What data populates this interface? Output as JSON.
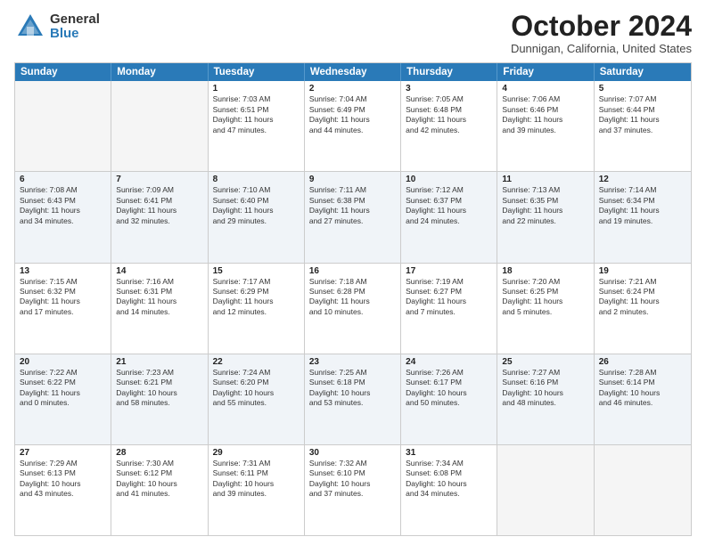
{
  "header": {
    "logo": {
      "general": "General",
      "blue": "Blue"
    },
    "title": "October 2024",
    "location": "Dunnigan, California, United States"
  },
  "weekdays": [
    "Sunday",
    "Monday",
    "Tuesday",
    "Wednesday",
    "Thursday",
    "Friday",
    "Saturday"
  ],
  "rows": [
    {
      "alt": false,
      "cells": [
        {
          "day": "",
          "empty": true
        },
        {
          "day": "",
          "empty": true
        },
        {
          "day": "1",
          "lines": [
            "Sunrise: 7:03 AM",
            "Sunset: 6:51 PM",
            "Daylight: 11 hours",
            "and 47 minutes."
          ]
        },
        {
          "day": "2",
          "lines": [
            "Sunrise: 7:04 AM",
            "Sunset: 6:49 PM",
            "Daylight: 11 hours",
            "and 44 minutes."
          ]
        },
        {
          "day": "3",
          "lines": [
            "Sunrise: 7:05 AM",
            "Sunset: 6:48 PM",
            "Daylight: 11 hours",
            "and 42 minutes."
          ]
        },
        {
          "day": "4",
          "lines": [
            "Sunrise: 7:06 AM",
            "Sunset: 6:46 PM",
            "Daylight: 11 hours",
            "and 39 minutes."
          ]
        },
        {
          "day": "5",
          "lines": [
            "Sunrise: 7:07 AM",
            "Sunset: 6:44 PM",
            "Daylight: 11 hours",
            "and 37 minutes."
          ]
        }
      ]
    },
    {
      "alt": true,
      "cells": [
        {
          "day": "6",
          "lines": [
            "Sunrise: 7:08 AM",
            "Sunset: 6:43 PM",
            "Daylight: 11 hours",
            "and 34 minutes."
          ]
        },
        {
          "day": "7",
          "lines": [
            "Sunrise: 7:09 AM",
            "Sunset: 6:41 PM",
            "Daylight: 11 hours",
            "and 32 minutes."
          ]
        },
        {
          "day": "8",
          "lines": [
            "Sunrise: 7:10 AM",
            "Sunset: 6:40 PM",
            "Daylight: 11 hours",
            "and 29 minutes."
          ]
        },
        {
          "day": "9",
          "lines": [
            "Sunrise: 7:11 AM",
            "Sunset: 6:38 PM",
            "Daylight: 11 hours",
            "and 27 minutes."
          ]
        },
        {
          "day": "10",
          "lines": [
            "Sunrise: 7:12 AM",
            "Sunset: 6:37 PM",
            "Daylight: 11 hours",
            "and 24 minutes."
          ]
        },
        {
          "day": "11",
          "lines": [
            "Sunrise: 7:13 AM",
            "Sunset: 6:35 PM",
            "Daylight: 11 hours",
            "and 22 minutes."
          ]
        },
        {
          "day": "12",
          "lines": [
            "Sunrise: 7:14 AM",
            "Sunset: 6:34 PM",
            "Daylight: 11 hours",
            "and 19 minutes."
          ]
        }
      ]
    },
    {
      "alt": false,
      "cells": [
        {
          "day": "13",
          "lines": [
            "Sunrise: 7:15 AM",
            "Sunset: 6:32 PM",
            "Daylight: 11 hours",
            "and 17 minutes."
          ]
        },
        {
          "day": "14",
          "lines": [
            "Sunrise: 7:16 AM",
            "Sunset: 6:31 PM",
            "Daylight: 11 hours",
            "and 14 minutes."
          ]
        },
        {
          "day": "15",
          "lines": [
            "Sunrise: 7:17 AM",
            "Sunset: 6:29 PM",
            "Daylight: 11 hours",
            "and 12 minutes."
          ]
        },
        {
          "day": "16",
          "lines": [
            "Sunrise: 7:18 AM",
            "Sunset: 6:28 PM",
            "Daylight: 11 hours",
            "and 10 minutes."
          ]
        },
        {
          "day": "17",
          "lines": [
            "Sunrise: 7:19 AM",
            "Sunset: 6:27 PM",
            "Daylight: 11 hours",
            "and 7 minutes."
          ]
        },
        {
          "day": "18",
          "lines": [
            "Sunrise: 7:20 AM",
            "Sunset: 6:25 PM",
            "Daylight: 11 hours",
            "and 5 minutes."
          ]
        },
        {
          "day": "19",
          "lines": [
            "Sunrise: 7:21 AM",
            "Sunset: 6:24 PM",
            "Daylight: 11 hours",
            "and 2 minutes."
          ]
        }
      ]
    },
    {
      "alt": true,
      "cells": [
        {
          "day": "20",
          "lines": [
            "Sunrise: 7:22 AM",
            "Sunset: 6:22 PM",
            "Daylight: 11 hours",
            "and 0 minutes."
          ]
        },
        {
          "day": "21",
          "lines": [
            "Sunrise: 7:23 AM",
            "Sunset: 6:21 PM",
            "Daylight: 10 hours",
            "and 58 minutes."
          ]
        },
        {
          "day": "22",
          "lines": [
            "Sunrise: 7:24 AM",
            "Sunset: 6:20 PM",
            "Daylight: 10 hours",
            "and 55 minutes."
          ]
        },
        {
          "day": "23",
          "lines": [
            "Sunrise: 7:25 AM",
            "Sunset: 6:18 PM",
            "Daylight: 10 hours",
            "and 53 minutes."
          ]
        },
        {
          "day": "24",
          "lines": [
            "Sunrise: 7:26 AM",
            "Sunset: 6:17 PM",
            "Daylight: 10 hours",
            "and 50 minutes."
          ]
        },
        {
          "day": "25",
          "lines": [
            "Sunrise: 7:27 AM",
            "Sunset: 6:16 PM",
            "Daylight: 10 hours",
            "and 48 minutes."
          ]
        },
        {
          "day": "26",
          "lines": [
            "Sunrise: 7:28 AM",
            "Sunset: 6:14 PM",
            "Daylight: 10 hours",
            "and 46 minutes."
          ]
        }
      ]
    },
    {
      "alt": false,
      "cells": [
        {
          "day": "27",
          "lines": [
            "Sunrise: 7:29 AM",
            "Sunset: 6:13 PM",
            "Daylight: 10 hours",
            "and 43 minutes."
          ]
        },
        {
          "day": "28",
          "lines": [
            "Sunrise: 7:30 AM",
            "Sunset: 6:12 PM",
            "Daylight: 10 hours",
            "and 41 minutes."
          ]
        },
        {
          "day": "29",
          "lines": [
            "Sunrise: 7:31 AM",
            "Sunset: 6:11 PM",
            "Daylight: 10 hours",
            "and 39 minutes."
          ]
        },
        {
          "day": "30",
          "lines": [
            "Sunrise: 7:32 AM",
            "Sunset: 6:10 PM",
            "Daylight: 10 hours",
            "and 37 minutes."
          ]
        },
        {
          "day": "31",
          "lines": [
            "Sunrise: 7:34 AM",
            "Sunset: 6:08 PM",
            "Daylight: 10 hours",
            "and 34 minutes."
          ]
        },
        {
          "day": "",
          "empty": true
        },
        {
          "day": "",
          "empty": true
        }
      ]
    }
  ]
}
